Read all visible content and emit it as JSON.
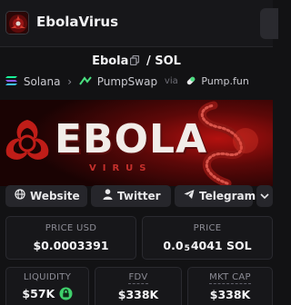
{
  "header": {
    "title": "EbolaVirus",
    "logo_icon": "biohazard-logo-icon"
  },
  "pair": {
    "base": "Ebola",
    "separator": "/",
    "quote": "SOL"
  },
  "chain": {
    "name": "Solana",
    "dex": "PumpSwap",
    "via_label": "via",
    "launchpad": "Pump.fun"
  },
  "banner": {
    "title": "EBOLA",
    "subtitle": "VIRUS"
  },
  "links": [
    {
      "label": "Website",
      "icon": "globe-icon"
    },
    {
      "label": "Twitter",
      "icon": "person-icon"
    },
    {
      "label": "Telegram",
      "icon": "paper-plane-icon"
    }
  ],
  "stats": {
    "price_usd": {
      "label": "PRICE USD",
      "value": "$0.0003391"
    },
    "price_sol": {
      "label": "PRICE",
      "value_prefix": "0.0",
      "value_sub": "5",
      "value_suffix": "4041 SOL"
    },
    "liquidity": {
      "label": "LIQUIDITY",
      "value": "$57K"
    },
    "fdv": {
      "label": "FDV",
      "value": "$338K"
    },
    "mkt_cap": {
      "label": "MKT CAP",
      "value": "$338K"
    }
  },
  "colors": {
    "background": "#121214",
    "card": "#17171a",
    "accent_red": "#c5302c",
    "lock_green": "#3fcf6b"
  }
}
